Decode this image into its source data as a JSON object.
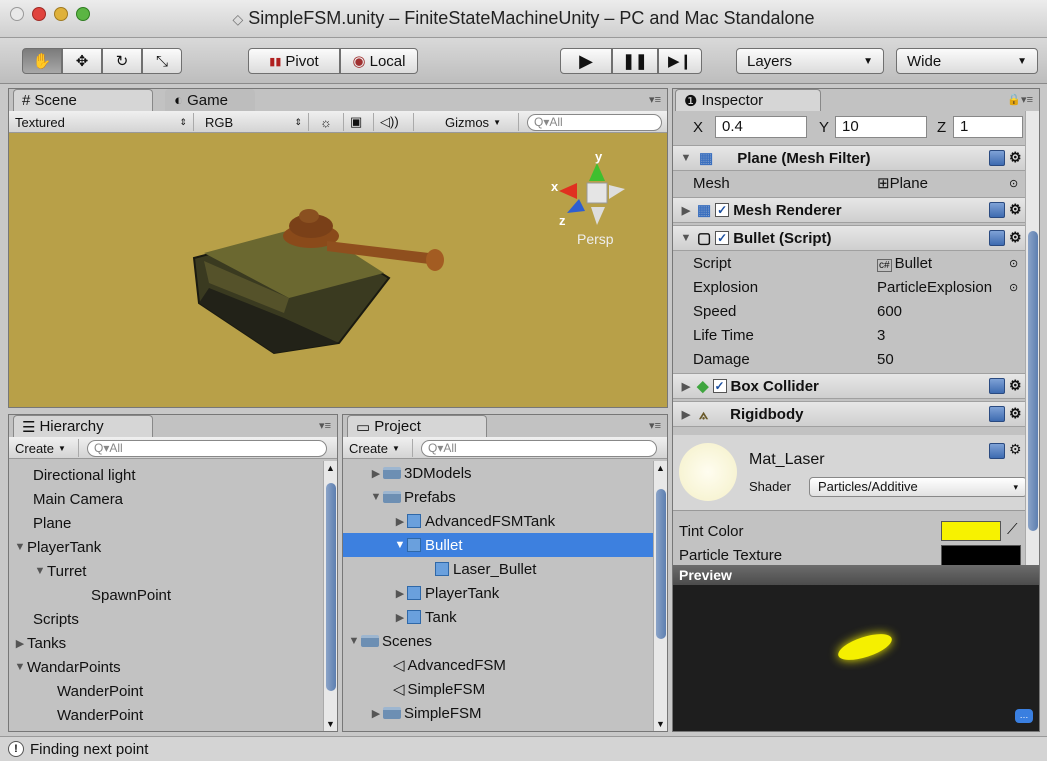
{
  "window": {
    "title": "SimpleFSM.unity – FiniteStateMachineUnity – PC and Mac Standalone"
  },
  "toolbar": {
    "pivot_label": "Pivot",
    "local_label": "Local",
    "layers_label": "Layers",
    "layout_label": "Wide"
  },
  "scene": {
    "tab_scene": "Scene",
    "tab_game": "Game",
    "render_mode": "Textured",
    "color_mode": "RGB",
    "gizmos_label": "Gizmos",
    "search_placeholder": "Q▾All",
    "axis_x": "x",
    "axis_y": "y",
    "axis_z": "z",
    "persp_label": "Persp"
  },
  "hierarchy": {
    "tab": "Hierarchy",
    "create_label": "Create",
    "search_placeholder": "Q▾All",
    "items": [
      {
        "label": "Directional light"
      },
      {
        "label": "Main Camera"
      },
      {
        "label": "Plane"
      },
      {
        "label": "PlayerTank"
      },
      {
        "label": "Turret"
      },
      {
        "label": "SpawnPoint"
      },
      {
        "label": "Scripts"
      },
      {
        "label": "Tanks"
      },
      {
        "label": "WandarPoints"
      },
      {
        "label": "WanderPoint"
      },
      {
        "label": "WanderPoint"
      }
    ]
  },
  "project": {
    "tab": "Project",
    "create_label": "Create",
    "search_placeholder": "Q▾All",
    "items": [
      {
        "label": "3DModels"
      },
      {
        "label": "Prefabs"
      },
      {
        "label": "AdvancedFSMTank"
      },
      {
        "label": "Bullet"
      },
      {
        "label": "Laser_Bullet"
      },
      {
        "label": "PlayerTank"
      },
      {
        "label": "Tank"
      },
      {
        "label": "Scenes"
      },
      {
        "label": "AdvancedFSM"
      },
      {
        "label": "SimpleFSM"
      },
      {
        "label": "SimpleFSM"
      }
    ]
  },
  "inspector": {
    "tab": "Inspector",
    "scale": {
      "x_label": "X",
      "x": "0.4",
      "y_label": "Y",
      "y": "10",
      "z_label": "Z",
      "z": "1"
    },
    "mesh_filter": {
      "title": "Plane (Mesh Filter)",
      "mesh_label": "Mesh",
      "mesh_value": "Plane"
    },
    "mesh_renderer": {
      "title": "Mesh Renderer"
    },
    "bullet_script": {
      "title": "Bullet (Script)",
      "script_label": "Script",
      "script_value": "Bullet",
      "explosion_label": "Explosion",
      "explosion_value": "ParticleExplosion",
      "speed_label": "Speed",
      "speed_value": "600",
      "lifetime_label": "Life Time",
      "lifetime_value": "3",
      "damage_label": "Damage",
      "damage_value": "50"
    },
    "box_collider": {
      "title": "Box Collider"
    },
    "rigidbody": {
      "title": "Rigidbody"
    },
    "material": {
      "name": "Mat_Laser",
      "shader_label": "Shader",
      "shader_value": "Particles/Additive"
    },
    "tint_label": "Tint Color",
    "particle_texture_label": "Particle Texture",
    "preview_label": "Preview",
    "colors": {
      "tint": "#f7f200",
      "selection": "#3d80df"
    }
  },
  "status": {
    "message": "Finding next point"
  }
}
